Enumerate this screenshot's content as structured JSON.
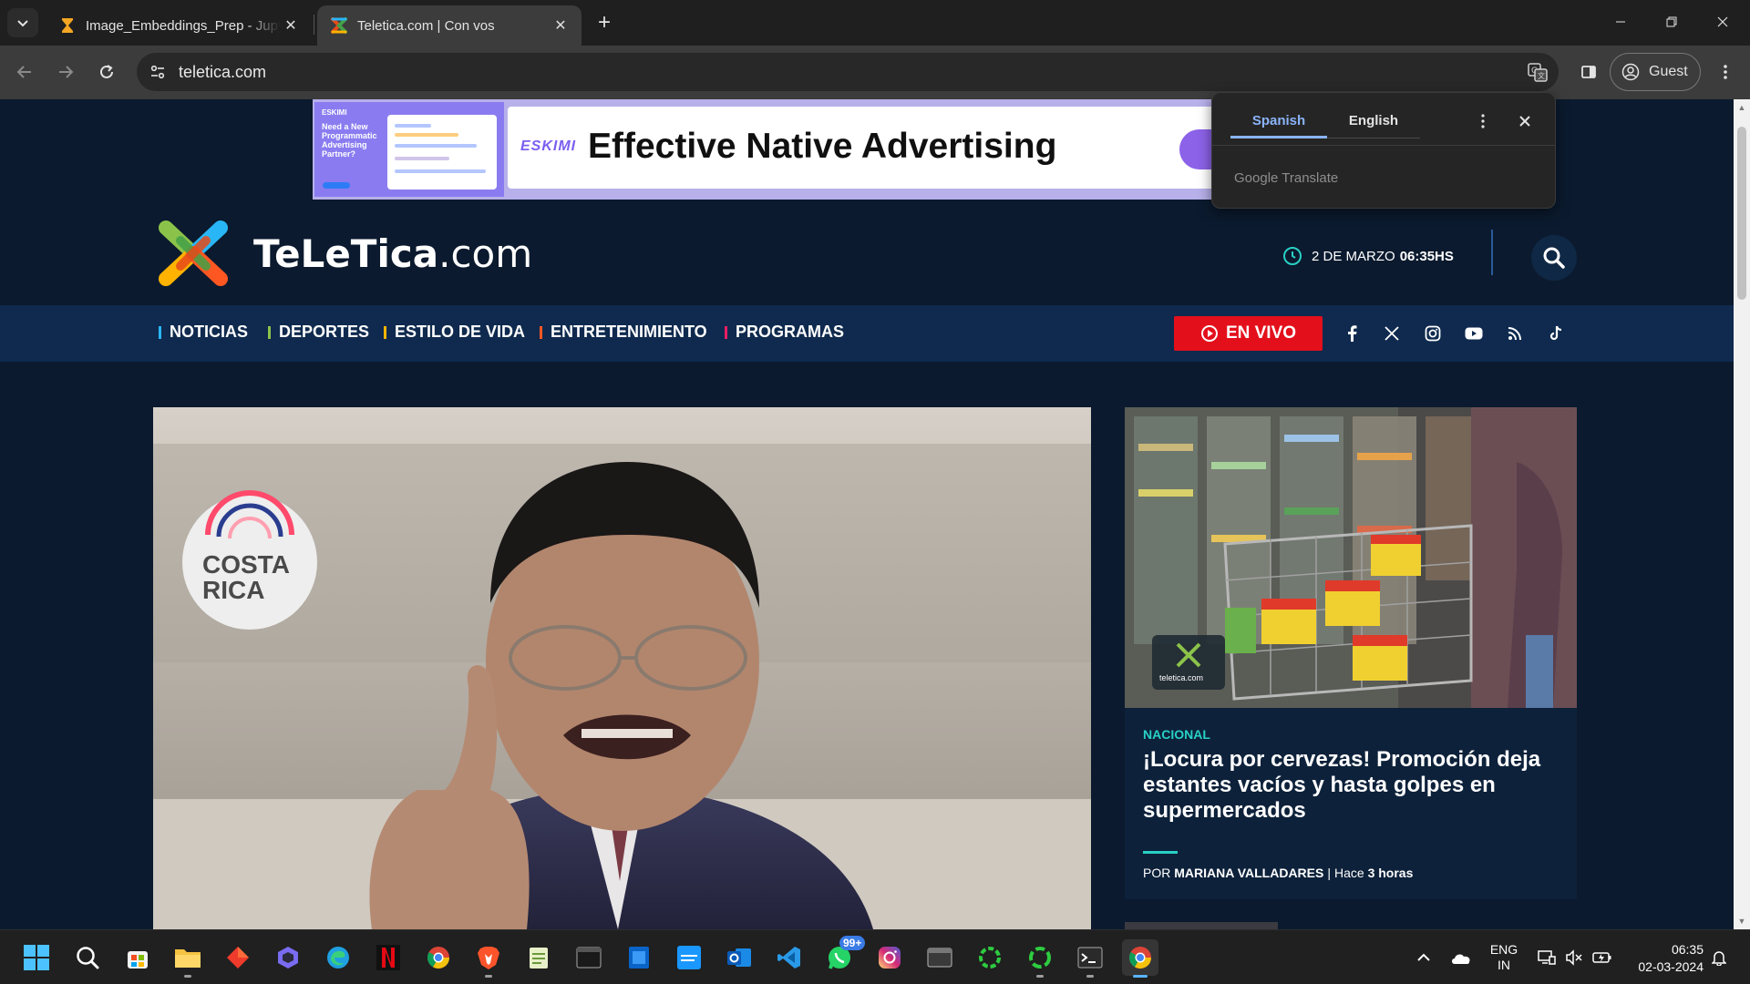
{
  "browser": {
    "tabs": [
      {
        "title": "Image_Embeddings_Prep - Jupyter",
        "state": "inactive"
      },
      {
        "title": "Teletica.com | Con vos",
        "state": "active"
      }
    ],
    "close_glyph": "✕",
    "new_tab_glyph": "+",
    "address": "teletica.com",
    "profile_label": "Guest"
  },
  "ad": {
    "left_brand": "ESKIMI",
    "left_copy": "Need a New Programmatic Advertising Partner?",
    "logo": "ESKIMI",
    "headline": "Effective Native Advertising"
  },
  "site": {
    "logo_text_bold": "TeLeTica",
    "logo_text_domain": ".com",
    "date": "2 DE MARZO",
    "time": "06:35HS",
    "nav": [
      {
        "label": "NOTICIAS",
        "accent": "#29b6f6"
      },
      {
        "label": "DEPORTES",
        "accent": "#8bc34a"
      },
      {
        "label": "ESTILO DE VIDA",
        "accent": "#ffb300"
      },
      {
        "label": "ENTRETENIMIENTO",
        "accent": "#ff5722"
      },
      {
        "label": "PROGRAMAS",
        "accent": "#e91e63"
      }
    ],
    "live_label": "EN VIVO",
    "social_icons": [
      "facebook-icon",
      "x-icon",
      "instagram-icon",
      "youtube-icon",
      "rss-icon",
      "tiktok-icon"
    ]
  },
  "hero": {
    "badge_text_line1": "COSTA",
    "badge_text_line2": "RICA"
  },
  "card": {
    "category": "NACIONAL",
    "headline": "¡Locura por cervezas! Promoción deja estantes vacíos y hasta golpes en supermercados",
    "by_prefix": "POR",
    "author": "MARIANA VALLADARES",
    "time_prefix": "Hace",
    "time_value": "3 horas",
    "photo_watermark": "teletica.com"
  },
  "translate_popup": {
    "languages": [
      "Spanish",
      "English"
    ],
    "selected": "Spanish",
    "brand": "Google Translate"
  },
  "taskbar": {
    "apps": [
      "start-icon",
      "search-icon",
      "store-icon",
      "file-explorer-icon",
      "app-red-icon",
      "copilot-icon",
      "edge-icon",
      "netflix-icon",
      "chrome-icon",
      "brave-icon",
      "notepad-icon",
      "terminal-icon",
      "snip-icon",
      "prime-video-icon",
      "outlook-icon",
      "vscode-icon",
      "whatsapp-icon",
      "instagram-icon",
      "window-icon",
      "ring-icon",
      "ring2-icon",
      "terminal2-icon",
      "chrome-active-icon"
    ],
    "whatsapp_badge": "99+",
    "lang_line1": "ENG",
    "lang_line2": "IN",
    "time": "06:35",
    "date": "02-03-2024"
  },
  "colors": {
    "site_bg": "#0b1a2e",
    "nav_bg": "#0f2a4e",
    "live_red": "#e3101b",
    "teal_accent": "#29d0c5",
    "translate_blue": "#8ab4f8"
  }
}
